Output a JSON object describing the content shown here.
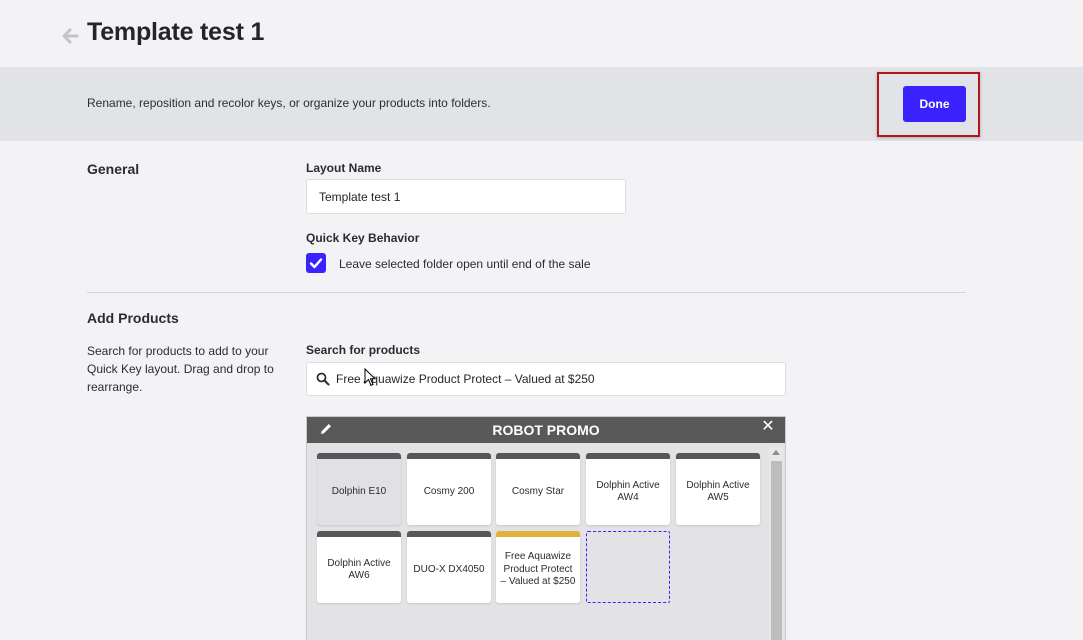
{
  "header": {
    "title": "Template test 1"
  },
  "banner": {
    "text": "Rename, reposition and recolor keys, or organize your products into folders.",
    "done_label": "Done"
  },
  "general": {
    "section_title": "General",
    "layout_name_label": "Layout Name",
    "layout_name_value": "Template test 1",
    "quick_key_label": "Quick Key Behavior",
    "checkbox_label": "Leave selected folder open until end of the sale",
    "checkbox_checked": true
  },
  "add_products": {
    "section_title": "Add Products",
    "description": "Search for products to add to your Quick Key layout. Drag and drop to rearrange.",
    "search_label": "Search for products",
    "search_value": "Free Aquawize Product Protect –  Valued at $250"
  },
  "folder": {
    "title": "ROBOT PROMO",
    "keys": [
      {
        "label": "Dolphin E10",
        "bar_color": "#555759",
        "selected": true
      },
      {
        "label": "Cosmy 200",
        "bar_color": "#555759"
      },
      {
        "label": "Cosmy Star",
        "bar_color": "#555759"
      },
      {
        "label": "Dolphin Active AW4",
        "bar_color": "#555759"
      },
      {
        "label": "Dolphin Active AW5",
        "bar_color": "#555759"
      },
      {
        "label": "Dolphin Active AW6",
        "bar_color": "#555759"
      },
      {
        "label": "DUO-X DX4050",
        "bar_color": "#555759"
      },
      {
        "label": "Free Aquawize Product Protect – Valued at $250",
        "bar_color": "#e2b13a"
      }
    ]
  },
  "colors": {
    "accent": "#3a22ff",
    "highlight_border": "#b5141a"
  },
  "icons": [
    "back-arrow-icon",
    "search-icon",
    "pencil-icon",
    "close-icon",
    "check-icon",
    "cursor-icon"
  ]
}
